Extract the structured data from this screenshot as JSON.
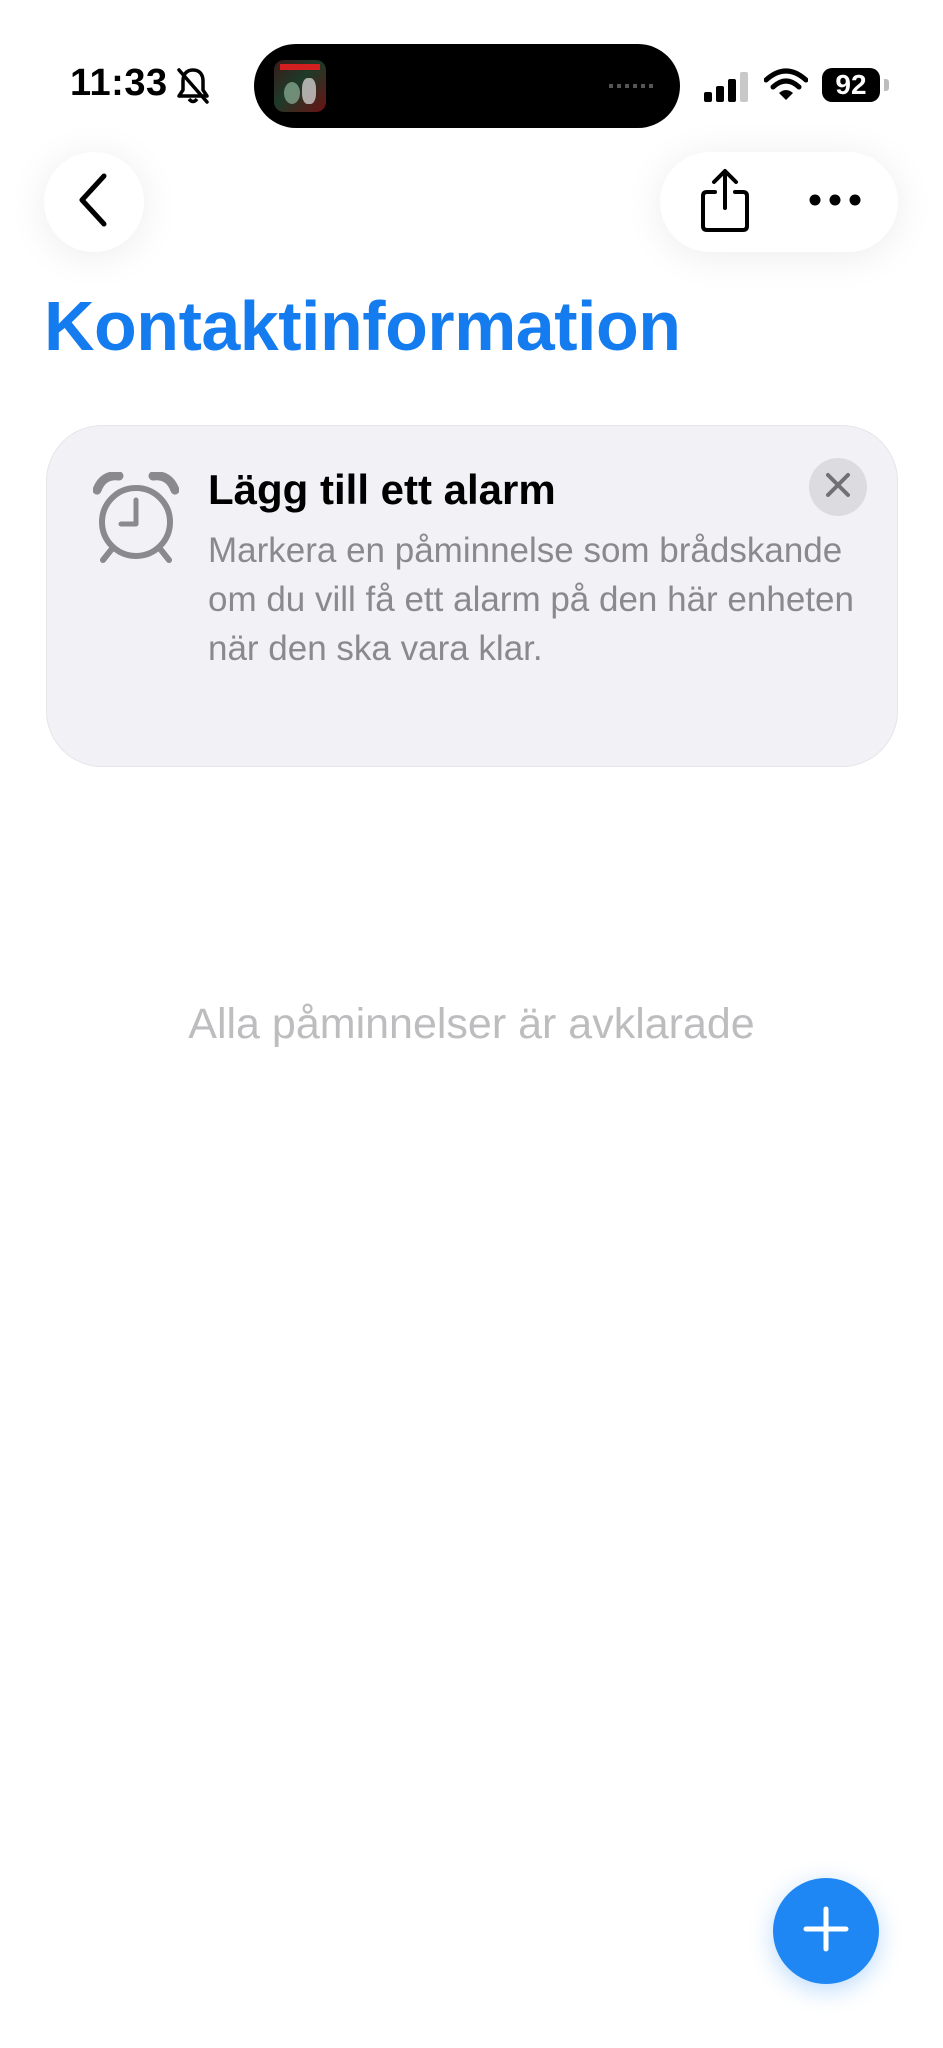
{
  "status_bar": {
    "time": "11:33",
    "battery": "92",
    "icons": [
      "bell-slash-icon",
      "signal-icon",
      "wifi-icon",
      "battery-icon"
    ]
  },
  "nav": {
    "back_icon": "chevron-left-icon",
    "share_icon": "share-icon",
    "more_icon": "ellipsis-icon"
  },
  "page": {
    "title": "Kontaktinformation",
    "accent_color": "#157cf0"
  },
  "tip": {
    "icon": "alarm-clock-icon",
    "title": "Lägg till ett alarm",
    "body": "Markera en påminnelse som brådskande om du vill få ett alarm på den här enheten när den ska vara klar.",
    "close_icon": "close-icon"
  },
  "empty_state": {
    "text": "Alla påminnelser är avklarade"
  },
  "fab": {
    "icon": "plus-icon",
    "color": "#1f87f3"
  }
}
